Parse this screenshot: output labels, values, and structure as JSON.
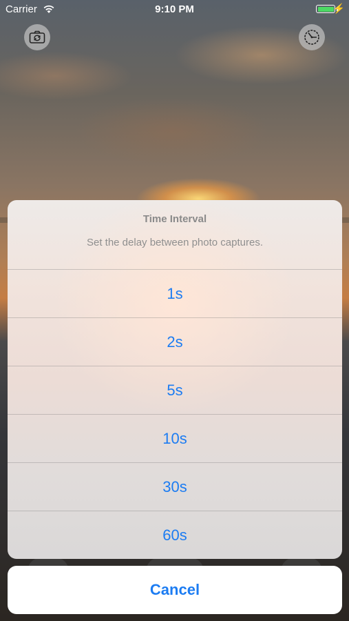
{
  "status_bar": {
    "carrier": "Carrier",
    "time": "9:10 PM",
    "battery_level": 1.0,
    "battery_color": "#4cd964"
  },
  "toolbar": {
    "left_icon": "camera-switch-icon",
    "right_icon": "timer-icon"
  },
  "action_sheet": {
    "title": "Time Interval",
    "message": "Set the delay between photo captures.",
    "options": [
      "1s",
      "2s",
      "5s",
      "10s",
      "30s",
      "60s"
    ],
    "cancel_label": "Cancel",
    "accent_color": "#1c7cf2"
  }
}
